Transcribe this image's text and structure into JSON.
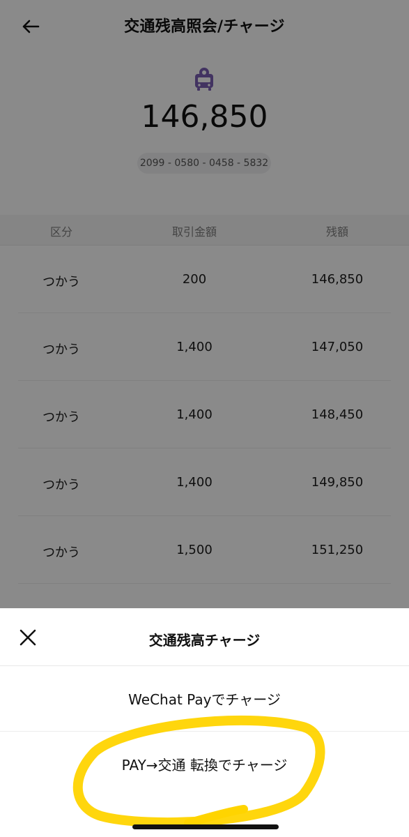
{
  "header": {
    "title": "交通残高照会/チャージ"
  },
  "balance": {
    "amount": "146,850",
    "card_number": "2099 - 0580 - 0458 - 5832"
  },
  "table": {
    "columns": [
      "区分",
      "取引金額",
      "残額"
    ],
    "rows": [
      [
        "つかう",
        "200",
        "146,850"
      ],
      [
        "つかう",
        "1,400",
        "147,050"
      ],
      [
        "つかう",
        "1,400",
        "148,450"
      ],
      [
        "つかう",
        "1,400",
        "149,850"
      ],
      [
        "つかう",
        "1,500",
        "151,250"
      ]
    ]
  },
  "sheet": {
    "title": "交通残高チャージ",
    "options": [
      "WeChat Payでチャージ",
      "PAY→交通 転換でチャージ"
    ]
  },
  "colors": {
    "overlay": "#757575",
    "highlight": "#ffd400",
    "bus_icon": "#7a5fb3"
  }
}
